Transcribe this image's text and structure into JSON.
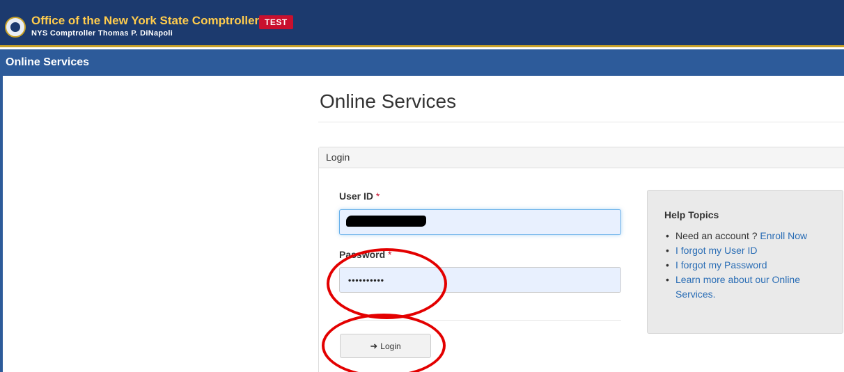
{
  "header": {
    "title": "Office of the New York State Comptroller",
    "subtitle": "NYS Comptroller Thomas P. DiNapoli",
    "badge": "TEST",
    "seal_icon": "nys-seal-icon"
  },
  "navbar": {
    "label": "Online Services"
  },
  "main": {
    "title": "Online Services"
  },
  "login_panel": {
    "heading": "Login",
    "user_id": {
      "label": "User ID",
      "required_marker": "*",
      "value": ""
    },
    "password": {
      "label": "Password",
      "required_marker": "*",
      "masked_value": "••••••••••"
    },
    "submit": {
      "label": "Login",
      "icon": "sign-in-icon"
    }
  },
  "help": {
    "title": "Help Topics",
    "items": [
      {
        "text": "Need an account ?",
        "link": "Enroll Now"
      },
      {
        "link": "I forgot my User ID"
      },
      {
        "link": "I forgot my Password"
      },
      {
        "link": "Learn more about our Online Services."
      }
    ]
  },
  "colors": {
    "header_bg": "#1c3a6e",
    "nav_bg": "#2d5b9a",
    "title_gold": "#ffcc4d",
    "badge_red": "#c8102e",
    "link_blue": "#2a6db5",
    "annotation_red": "#e30000"
  }
}
